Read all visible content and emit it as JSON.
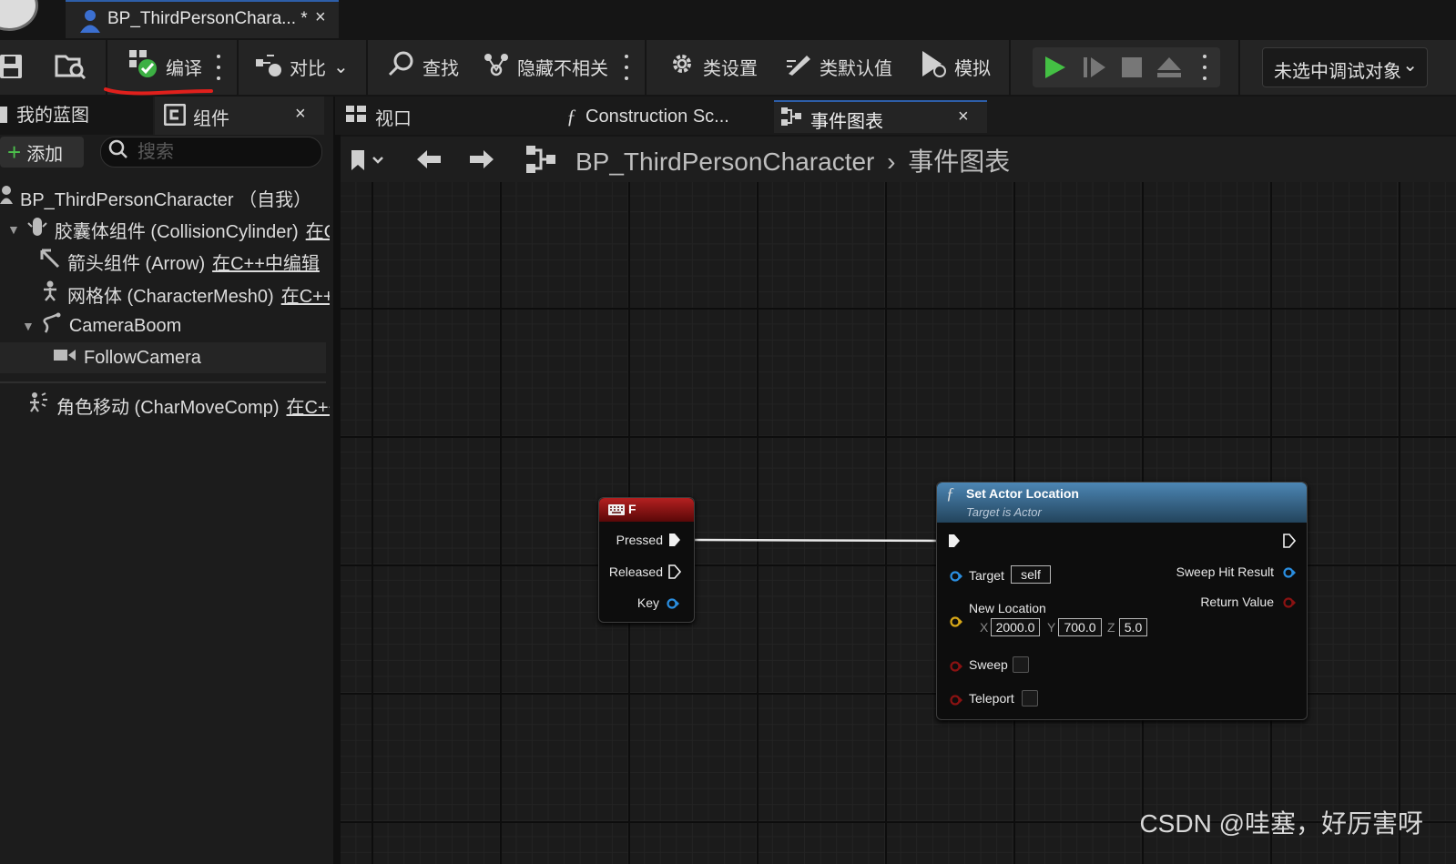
{
  "title_bar": {
    "document_tab": "BP_ThirdPersonChara...",
    "modified_marker": "*",
    "close": "×"
  },
  "toolbar": {
    "compile": "编译",
    "diff": "对比",
    "find": "查找",
    "hide_unrelated": "隐藏不相关",
    "class_settings": "类设置",
    "class_defaults": "类默认值",
    "simulate": "模拟",
    "debug_object": "未选中调试对象"
  },
  "left_panel": {
    "tab_my_blueprint": "我的蓝图",
    "tab_components": "组件",
    "tab_close": "×",
    "add_button": "添加",
    "search_placeholder": "搜索",
    "tree": [
      {
        "label": "BP_ThirdPersonCharacter （自我）",
        "edit": ""
      },
      {
        "label": "胶囊体组件 (CollisionCylinder)",
        "edit": "在C"
      },
      {
        "label": "箭头组件 (Arrow)",
        "edit": "在C++中编辑"
      },
      {
        "label": "网格体 (CharacterMesh0)",
        "edit": "在C++"
      },
      {
        "label": "CameraBoom",
        "edit": ""
      },
      {
        "label": "FollowCamera",
        "edit": ""
      },
      {
        "label": "角色移动 (CharMoveComp)",
        "edit": "在C++"
      }
    ]
  },
  "center_tabs": {
    "viewport": "视口",
    "construction": "Construction Sc...",
    "event_graph": "事件图表",
    "close": "×"
  },
  "breadcrumb": {
    "blueprint": "BP_ThirdPersonCharacter",
    "separator": "›",
    "graph": "事件图表"
  },
  "nodes": {
    "key_event": {
      "title": "F",
      "pins": {
        "pressed": "Pressed",
        "released": "Released",
        "key": "Key"
      }
    },
    "set_actor_location": {
      "title": "Set Actor Location",
      "subtitle": "Target is Actor",
      "target_label": "Target",
      "target_value": "self",
      "new_location_label": "New Location",
      "x_label": "X",
      "x_value": "2000.0",
      "y_label": "Y",
      "y_value": "700.0",
      "z_label": "Z",
      "z_value": "5.0",
      "sweep_label": "Sweep",
      "teleport_label": "Teleport",
      "sweep_hit_result": "Sweep Hit Result",
      "return_value": "Return Value"
    }
  },
  "watermark": "CSDN @哇塞，好厉害呀",
  "colors": {
    "accent_blue": "#2d5ea8",
    "compile_ok": "#3cb043",
    "play_green": "#44c044",
    "annotation_red": "#e0201c",
    "event_node_header": "#8a1010",
    "function_node_header": "#3a6f96",
    "object_pin": "#2a8ee0",
    "struct_pin": "#d8a818",
    "bool_pin": "#8a1212"
  },
  "icons": [
    "save-icon",
    "browse-icon",
    "compile-icon",
    "diff-icon",
    "find-icon",
    "hide-unrelated-icon",
    "gear-icon",
    "class-defaults-icon",
    "simulate-icon",
    "play-icon",
    "step-icon",
    "stop-icon",
    "eject-icon",
    "bookmark-icon",
    "back-arrow-icon",
    "forward-arrow-icon",
    "graph-icon",
    "function-icon",
    "keyboard-icon"
  ]
}
